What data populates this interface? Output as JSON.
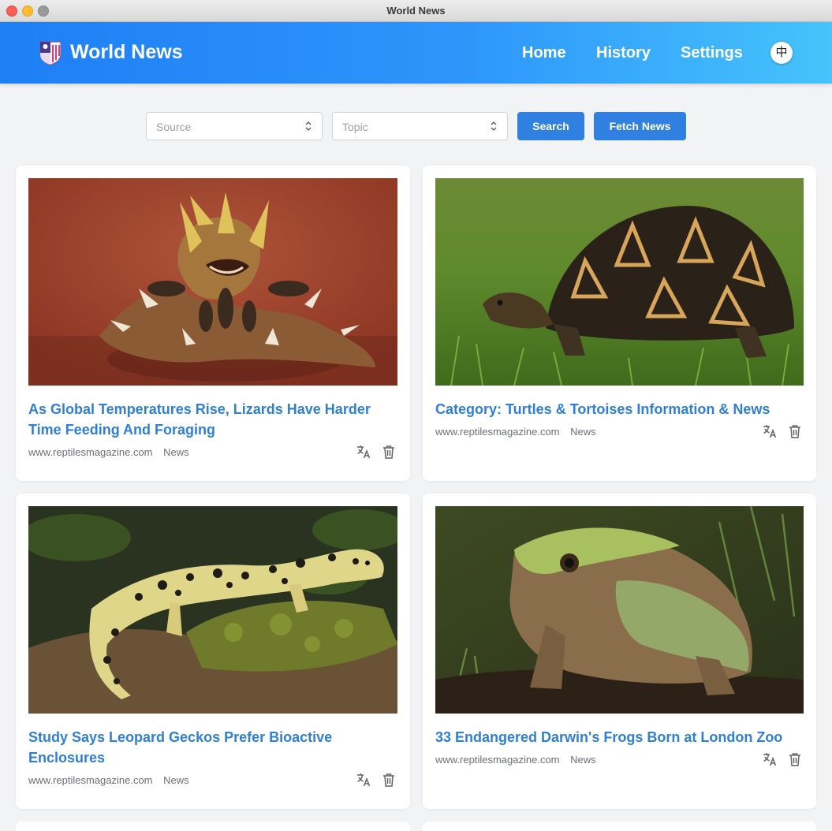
{
  "window": {
    "title": "World News"
  },
  "header": {
    "brand": "World News",
    "nav": {
      "home": "Home",
      "history": "History",
      "settings": "Settings"
    },
    "lang_toggle": "中"
  },
  "filters": {
    "source_placeholder": "Source",
    "topic_placeholder": "Topic",
    "search_label": "Search",
    "fetch_label": "Fetch News"
  },
  "articles": [
    {
      "title": "As Global Temperatures Rise, Lizards Have Harder Time Feeding And Foraging",
      "source": "www.reptilesmagazine.com",
      "category": "News",
      "image": "thorny-devil-lizard-photo"
    },
    {
      "title": "Category: Turtles & Tortoises Information & News",
      "source": "www.reptilesmagazine.com",
      "category": "News",
      "image": "radiated-tortoise-photo"
    },
    {
      "title": "Study Says Leopard Geckos Prefer Bioactive Enclosures",
      "source": "www.reptilesmagazine.com",
      "category": "News",
      "image": "leopard-gecko-photo"
    },
    {
      "title": "33 Endangered Darwin's Frogs Born at London Zoo",
      "source": "www.reptilesmagazine.com",
      "category": "News",
      "image": "darwins-frog-photo"
    }
  ],
  "colors": {
    "accent": "#2f80e0",
    "title_link": "#2f7fd6",
    "header_start": "#1e7ff5",
    "header_end": "#46c3fb"
  }
}
